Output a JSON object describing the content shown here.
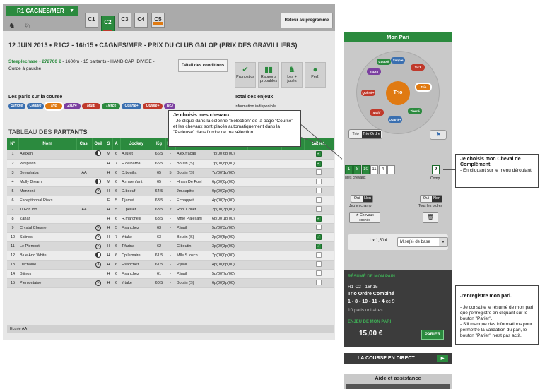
{
  "header": {
    "race_id": "R1 CAGNES/MER",
    "caret": "▼",
    "tabs": [
      "C1",
      "C2",
      "C3",
      "C4",
      "C5"
    ],
    "retour": "Retour au programme"
  },
  "race": {
    "title": "12 JUIN 2013 • R1C2 - 16h15 • CAGNES/MER - PRIX DU CLUB GALOP (PRIX DES GRAVILLIERS)",
    "type_bold": "Steeplechase - 272700 €",
    "type_rest": " - 1600m - 15 partants - HANDICAP_DIVISE -",
    "sub": "Corde à gauche",
    "details_btn": "Détail des conditions"
  },
  "tools": [
    {
      "icon": "✔",
      "label": "Pronostics"
    },
    {
      "icon": "▮▮",
      "label": "Rapports probables"
    },
    {
      "icon": "♞",
      "label": "Les + joués"
    },
    {
      "icon": "●",
      "label": "Perf."
    }
  ],
  "paris": {
    "label": "Les paris sur la course",
    "types": [
      {
        "name": "Simple",
        "color": "#3a6fb0"
      },
      {
        "name": "Couplé",
        "color": "#3a6fb0"
      },
      {
        "name": "Trio",
        "color": "#e07a12"
      },
      {
        "name": "2sur4",
        "color": "#7b3fa0"
      },
      {
        "name": "Multi",
        "color": "#c0392b"
      },
      {
        "name": "Tiercé",
        "color": "#2b8a3e"
      },
      {
        "name": "Quarté+",
        "color": "#3a6fb0"
      },
      {
        "name": "Quinté+",
        "color": "#c0392b"
      },
      {
        "name": "Tic3",
        "color": "#7b3fa0"
      }
    ]
  },
  "enjeux": {
    "label": "Total des enjeux",
    "info": "Information indisponible"
  },
  "tableau": {
    "label_a": "TABLEAU DES ",
    "label_b": "PARTANTS"
  },
  "columns": [
    "N°",
    "Nom",
    "Cas.",
    "Oeil",
    "S",
    "A",
    "Jockey",
    "Kg",
    "Dé.",
    "",
    "",
    "",
    "",
    "",
    "",
    "Sélect."
  ],
  "runners": [
    {
      "n": "1",
      "nom": "Aleixan",
      "cas": "",
      "oeil": "half",
      "s": "M",
      "a": "6",
      "jockey": "A.juret",
      "kg": "66.5",
      "de": "-",
      "p": "Alex.fracas",
      "m": "7p(00)6p(00)",
      "sel": true
    },
    {
      "n": "2",
      "nom": "Whiplash",
      "cas": "",
      "oeil": "",
      "s": "H",
      "a": "7",
      "jockey": "E.delbarba",
      "kg": "65.5",
      "de": "-",
      "p": "Boutin (S)",
      "m": "7p(00)8p(00)",
      "sel": true
    },
    {
      "n": "3",
      "nom": "Beershaba",
      "cas": "AA",
      "oeil": "",
      "s": "H",
      "a": "6",
      "jockey": "D.bonilla",
      "kg": "65",
      "de": "5",
      "p": "Boutin (S)",
      "m": "7p(00)1p(00)",
      "sel": false
    },
    {
      "n": "4",
      "nom": "Molly Dream",
      "cas": "",
      "oeil": "half",
      "s": "M",
      "a": "6",
      "jockey": "A.malenfant",
      "kg": "65",
      "de": "-",
      "p": "H.van De Poel",
      "m": "6p(00)0p(00)",
      "sel": false
    },
    {
      "n": "5",
      "nom": "Menzoni",
      "cas": "",
      "oeil": "circ",
      "s": "H",
      "a": "6",
      "jockey": "D.boeuf",
      "kg": "64.5",
      "de": "-",
      "p": "Jm.capitte",
      "m": "0p(00)2p(00)",
      "sel": false
    },
    {
      "n": "6",
      "nom": "Exceptionnal Risks",
      "cas": "",
      "oeil": "",
      "s": "F",
      "a": "5",
      "jockey": "T.jamet",
      "kg": "63.5",
      "de": "-",
      "p": "F.chappet",
      "m": "4p(00)3p(00)",
      "sel": false
    },
    {
      "n": "7",
      "nom": "Ti For Too",
      "cas": "AA",
      "oeil": "",
      "s": "H",
      "a": "5",
      "jockey": "O.pellier",
      "kg": "63.5",
      "de": "2",
      "p": "Rob. Collet",
      "m": "2p(00)3p(00)",
      "sel": false
    },
    {
      "n": "8",
      "nom": "Zahar",
      "cas": "",
      "oeil": "",
      "s": "H",
      "a": "6",
      "jockey": "R.marchelli",
      "kg": "63.5",
      "de": "-",
      "p": "Mme P.alexani",
      "m": "6p(00)1p(00)",
      "sel": true
    },
    {
      "n": "9",
      "nom": "Crystal Chesne",
      "cas": "",
      "oeil": "circ",
      "s": "H",
      "a": "5",
      "jockey": "F.sanchez",
      "kg": "63",
      "de": "-",
      "p": "P.juail",
      "m": "5p(00)3p(00)",
      "sel": false
    },
    {
      "n": "10",
      "nom": "Skiinos",
      "cas": "",
      "oeil": "circ",
      "s": "H",
      "a": "7",
      "jockey": "Y.take",
      "kg": "63",
      "de": "-",
      "p": "Boutin (S)",
      "m": "2p(00)5p(00)",
      "sel": true
    },
    {
      "n": "11",
      "nom": "Le Piemont",
      "cas": "",
      "oeil": "circ",
      "s": "H",
      "a": "6",
      "jockey": "T.farina",
      "kg": "62",
      "de": "-",
      "p": "C.boutin",
      "m": "3p(00)3p(00)",
      "sel": true
    },
    {
      "n": "12",
      "nom": "Blue And White",
      "cas": "",
      "oeil": "half",
      "s": "H",
      "a": "6",
      "jockey": "Cp.lemaire",
      "kg": "61.5",
      "de": "-",
      "p": "Mlle S.losch",
      "m": "7p(00)0p(00)",
      "sel": false
    },
    {
      "n": "13",
      "nom": "Dechaine",
      "cas": "",
      "oeil": "circ",
      "s": "H",
      "a": "6",
      "jockey": "F.sanchez",
      "kg": "61.5",
      "de": "-",
      "p": "P.juail",
      "m": "4p(00)6p(00)",
      "sel": false
    },
    {
      "n": "14",
      "nom": "Bijinos",
      "cas": "",
      "oeil": "",
      "s": "H",
      "a": "6",
      "jockey": "F.sanchez",
      "kg": "61",
      "de": "-",
      "p": "P.juail",
      "m": "5p(00)7p(00)",
      "sel": false
    },
    {
      "n": "15",
      "nom": "Piemontaise",
      "cas": "",
      "oeil": "circ",
      "s": "H",
      "a": "6",
      "jockey": "Y.take",
      "kg": "60.5",
      "de": "-",
      "p": "Boutin (S)",
      "m": "6p(00)2p(00)",
      "sel": false
    }
  ],
  "ecurie": "Ecurie AA",
  "callouts": {
    "c1_head": "Je choisis mes chevaux.",
    "c1_body": "- Je clique dans la colonne \"Sélection\" de la page \"Course\" et les chevaux sont placés automatiquement dans la \"Parieuse\" dans l'ordre de ma sélection.",
    "c2_head": "Je choisis mon Cheval de Complément.",
    "c2_body": "- En cliquant sur le menu déroulant.",
    "c3_head": "J'enregistre mon pari.",
    "c3_body": "- Je consulte le résumé de mon pari que j'enregistre en cliquant sur le bouton \"Parier\".\n- S'il manque des informations pour permettre la validation du pari, le bouton \"Parier\" n'est pas actif."
  },
  "mon_pari": {
    "title": "Mon Pari",
    "center": "Trio",
    "wheel": [
      {
        "name": "Simple",
        "color": "#3a6fb0"
      },
      {
        "name": "Tic3",
        "color": "#c0392b"
      },
      {
        "name": "Trio",
        "color": "#e07a12"
      },
      {
        "name": "Tiercé",
        "color": "#2b8a3e"
      },
      {
        "name": "Quarté+",
        "color": "#3a6fb0"
      },
      {
        "name": "Multi",
        "color": "#c0392b"
      },
      {
        "name": "Quinté+",
        "color": "#c0392b"
      },
      {
        "name": "2sur4",
        "color": "#7b3fa0"
      },
      {
        "name": "Couplé",
        "color": "#2b8a3e"
      }
    ],
    "bt_opt1": "Trio",
    "bt_opt2": "Trio Ordre",
    "sel_nums": [
      "1",
      "8",
      "10",
      "11",
      "4",
      ""
    ],
    "mes_chevaux": "Mes chevaux",
    "comp_val": "9",
    "comp_lbl": "Comp.",
    "oui": "Oui",
    "non": "Non",
    "jeu_en_champ": "Jeu en champ",
    "tous_les_ordres": "Tous les ordres",
    "chevaux_coches": "Chevaux cochés",
    "mise_val": "1 x 1,50 €",
    "mise_sel": "Mise(s) de base",
    "resume_title": "RÉSUMÉ DE MON PARI",
    "resume_race": "R1-C2 - 16h15",
    "resume_type": "Trio Ordre Combiné",
    "resume_combo": "1 - 8 - 10 - 11 - 4",
    "resume_cc": "cc 9",
    "resume_paris": "10 paris unitaires",
    "enjeu_title": "ENJEU DE MON PARI",
    "enjeu_val": "15,00 €",
    "parier": "PARIER"
  },
  "direct": "LA COURSE EN DIRECT",
  "aide": "Aide et assistance"
}
